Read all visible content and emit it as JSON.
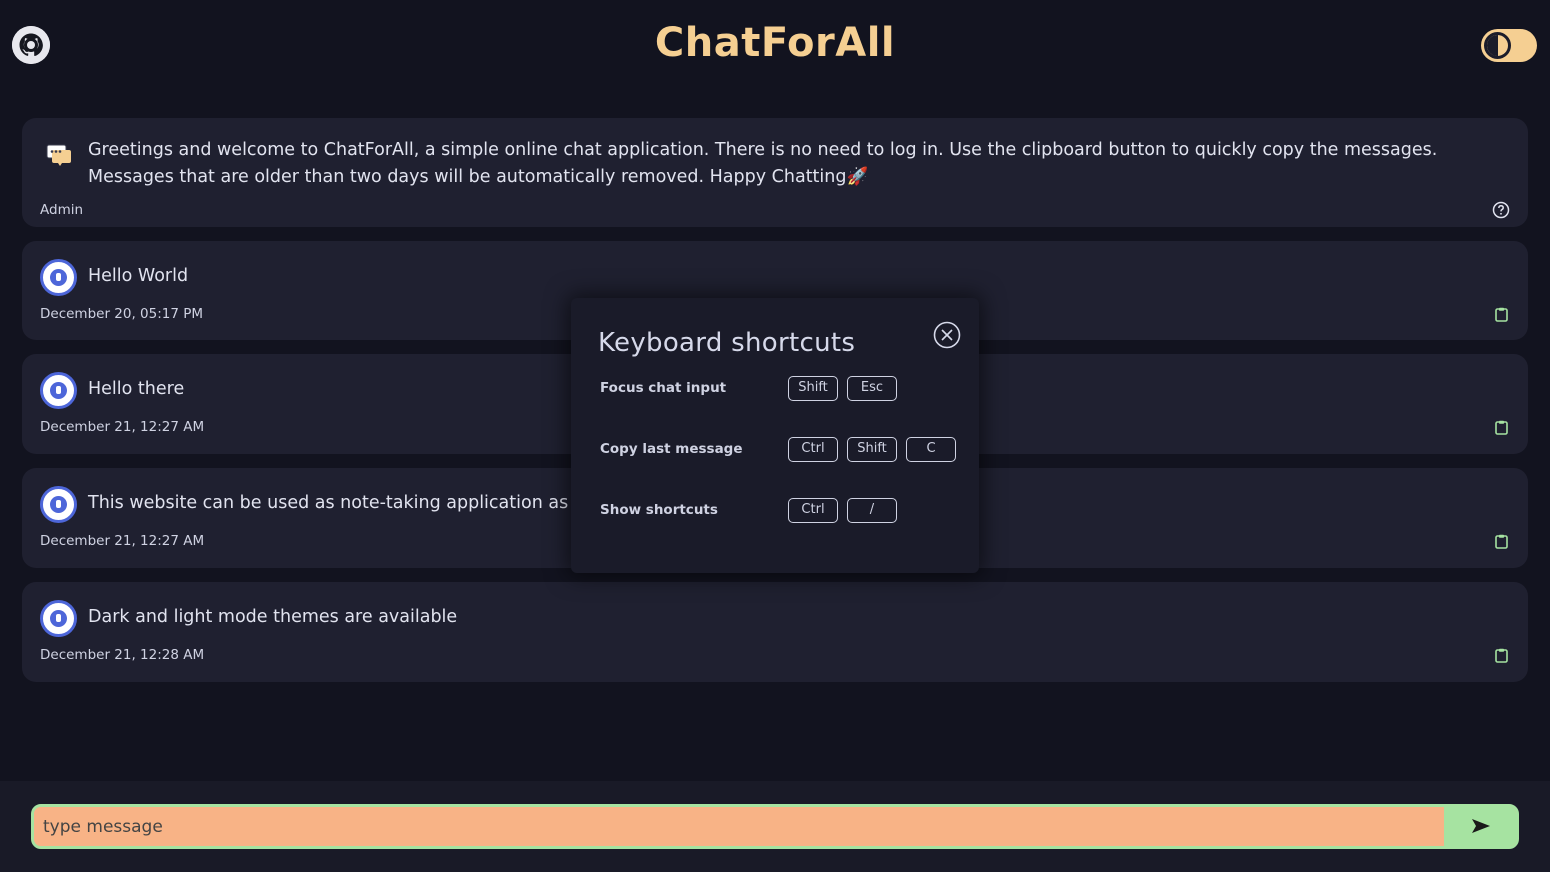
{
  "header": {
    "title": "ChatForAll",
    "github_icon": "github-icon",
    "theme_toggle_icon": "theme-toggle"
  },
  "welcome": {
    "text": "Greetings and welcome to ChatForAll, a simple online chat application. There is no need to log in. Use the clipboard button to quickly copy the messages. Messages that are older than two days will be automatically removed. Happy Chatting🚀",
    "author": "Admin",
    "icon": "chat-bubble-icon",
    "help_icon": "help-icon"
  },
  "messages": [
    {
      "text": "Hello World",
      "time": "December 20, 05:17 PM"
    },
    {
      "text": "Hello there",
      "time": "December 21, 12:27 AM"
    },
    {
      "text": "This website can be used as note-taking application as v",
      "time": "December 21, 12:27 AM"
    },
    {
      "text": "Dark and light mode themes are available",
      "time": "December 21, 12:28 AM"
    }
  ],
  "shortcuts": {
    "title": "Keyboard shortcuts",
    "close_icon": "close-icon",
    "items": [
      {
        "label": "Focus chat input",
        "keys": [
          "Shift",
          "Esc"
        ]
      },
      {
        "label": "Copy last message",
        "keys": [
          "Ctrl",
          "Shift",
          "C"
        ]
      },
      {
        "label": "Show shortcuts",
        "keys": [
          "Ctrl",
          "/"
        ]
      }
    ]
  },
  "composer": {
    "placeholder": "type message",
    "send_icon": "send-icon"
  },
  "colors": {
    "accent": "#f5cf92",
    "input_bg": "#f8b386",
    "input_border": "#a6e3a1",
    "avatar_blue": "#4d66d9"
  }
}
